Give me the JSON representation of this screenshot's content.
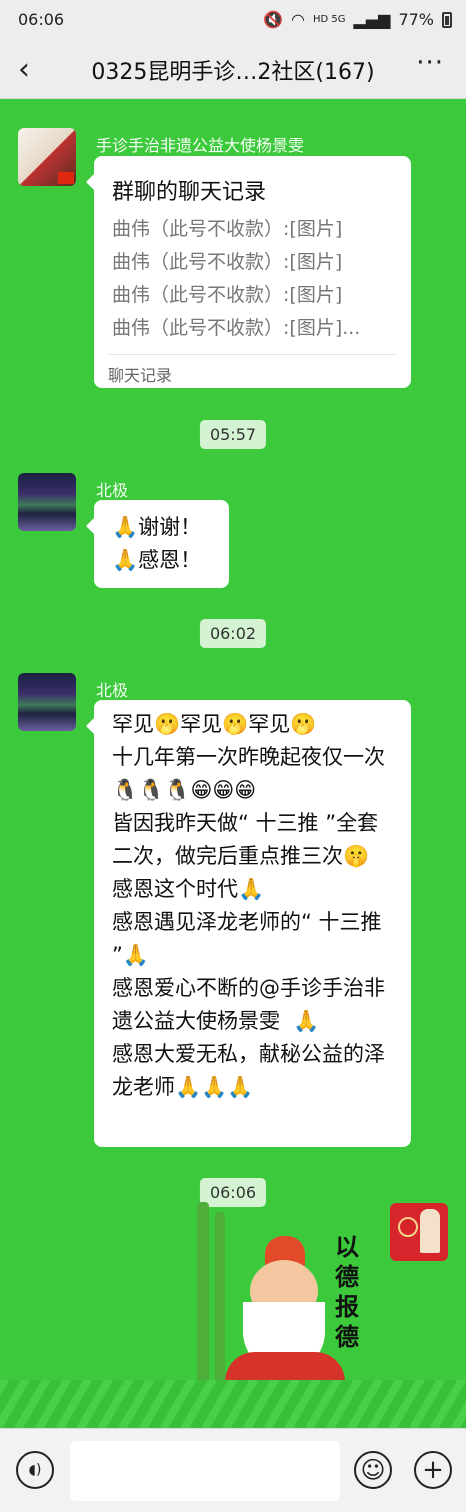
{
  "status": {
    "time": "06:06",
    "network": "HD 5G",
    "battery": "77%"
  },
  "header": {
    "back": "‹",
    "title": "0325昆明手诊…2社区(167)",
    "more": "···"
  },
  "messages": {
    "m1": {
      "sender": "手诊手治非遗公益大使杨景雯",
      "record_title": "群聊的聊天记录",
      "lines": [
        "曲伟（此号不收款）:[图片]",
        "曲伟（此号不收款）:[图片]",
        "曲伟（此号不收款）:[图片]",
        "曲伟（此号不收款）:[图片]..."
      ],
      "footer": "聊天记录"
    },
    "t1": "05:57",
    "m2": {
      "sender": "北极",
      "text": "🙏谢谢！\n🙏感恩！"
    },
    "t2": "06:02",
    "m3": {
      "sender": "北极",
      "text": "罕见🫢罕见🫢罕见🫢\n十几年第一次昨晚起夜仅一次🐧🐧🐧😁😁😁\n皆因我昨天做“ 十三推 ”全套二次，做完后重点推三次🤫\n感恩这个时代🙏\n感恩遇见泽龙老师的“ 十三推 ”🙏\n感恩爱心不断的@手诊手治非遗公益大使杨景雯  🙏\n感恩大爱无私，献秘公益的泽龙老师🙏🙏🙏"
    },
    "t3": "06:06",
    "m4": {
      "sticker_text": "以德报德"
    }
  },
  "inputbar": {
    "voice": "◖)",
    "emoji": "☺",
    "plus": "+"
  },
  "colors": {
    "background": "#3cc93c",
    "bubble": "#ffffff",
    "time_pill": "#d3f3d3"
  }
}
